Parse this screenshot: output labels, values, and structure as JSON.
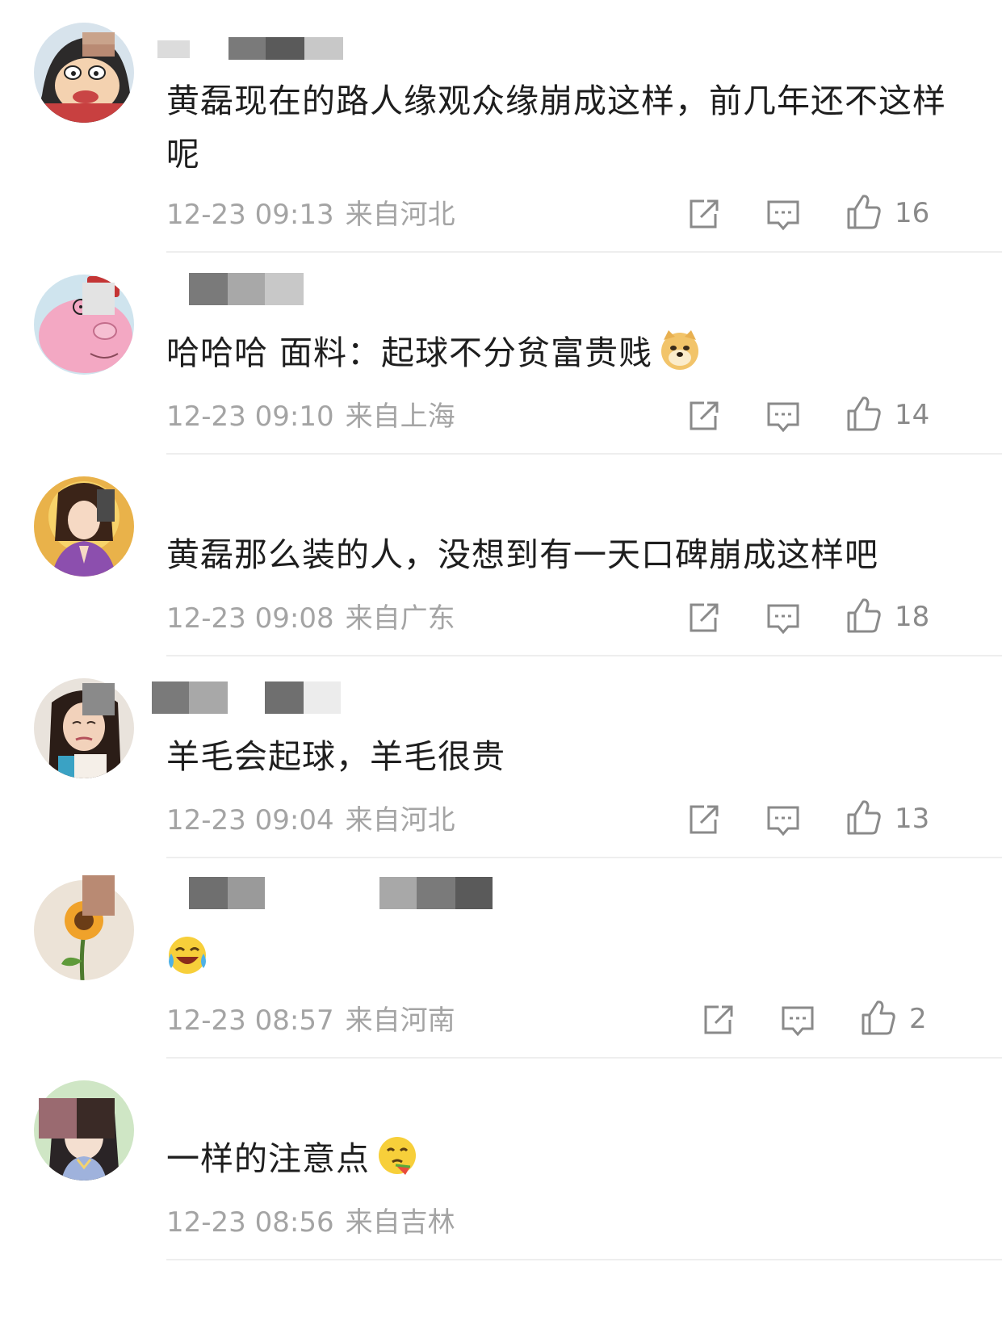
{
  "comments": [
    {
      "text": "黄磊现在的路人缘观众缘崩成这样，前几年还不这样呢",
      "time": "12-23 09:13",
      "location": "来自河北",
      "likes": "16"
    },
    {
      "text": "哈哈哈 面料：起球不分贫富贵贱",
      "emoji": "doge-emoji",
      "time": "12-23 09:10",
      "location": "来自上海",
      "likes": "14"
    },
    {
      "text": "黄磊那么装的人，没想到有一天口碑崩成这样吧",
      "time": "12-23 09:08",
      "location": "来自广东",
      "likes": "18"
    },
    {
      "text": "羊毛会起球，羊毛很贵",
      "time": "12-23 09:04",
      "location": "来自河北",
      "likes": "13"
    },
    {
      "text": "",
      "emoji": "laugh-cry-emoji",
      "time": "12-23 08:57",
      "location": "来自河南",
      "likes": "2"
    },
    {
      "text": "一样的注意点",
      "emoji": "eating-emoji",
      "time": "12-23 08:56",
      "location": "来自吉林",
      "likes": ""
    }
  ],
  "icons": {
    "repost": "repost-icon",
    "reply": "comment-icon",
    "like": "thumbs-up-icon"
  },
  "colors": {
    "meta_text": "#a4a4a4",
    "icon_stroke": "#8a8a8a",
    "divider": "#eeeeee",
    "censor_dark": "#7a7a7a",
    "censor_light": "#c8c8c8"
  }
}
